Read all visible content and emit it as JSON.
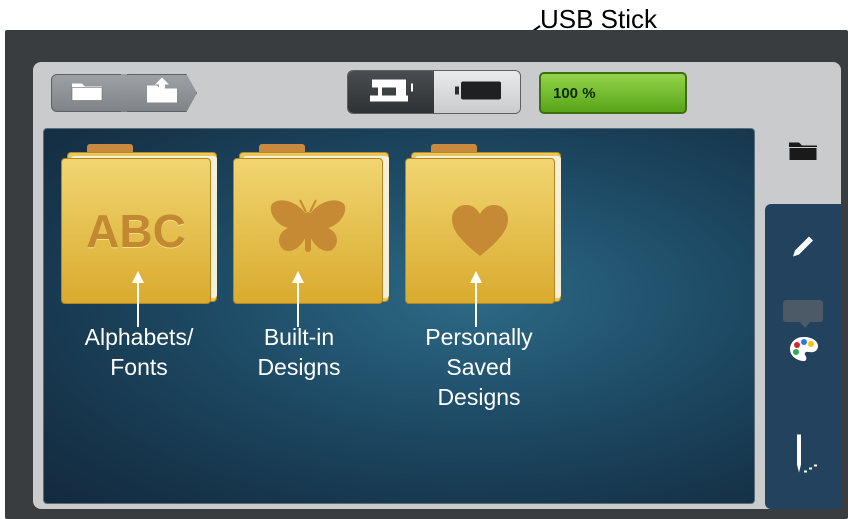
{
  "callout": {
    "label": "USB Stick"
  },
  "breadcrumb": {
    "items": [
      {
        "icon": "folder-icon"
      },
      {
        "icon": "folder-upload-icon"
      }
    ]
  },
  "source_toggle": {
    "options": [
      {
        "icon": "sewing-machine-icon",
        "selected": false
      },
      {
        "icon": "usb-stick-icon",
        "selected": true
      }
    ]
  },
  "memory": {
    "label": "100 %",
    "fill_fraction": 1.0,
    "color": "#6fbf2a"
  },
  "side_tabs": [
    {
      "icon": "folder-icon",
      "active": true
    },
    {
      "icon": "pencil-icon",
      "active": false
    },
    {
      "icon": "palette-icon",
      "active": false
    },
    {
      "icon": "needle-stitch-icon",
      "active": false
    }
  ],
  "folders": [
    {
      "emblem_text": "ABC",
      "emblem": "abc-text"
    },
    {
      "emblem": "butterfly-icon"
    },
    {
      "emblem": "heart-icon"
    }
  ],
  "annotations": [
    {
      "lines": [
        "Alphabets/",
        "Fonts"
      ]
    },
    {
      "lines": [
        "Built-in",
        "Designs"
      ]
    },
    {
      "lines": [
        "Personally",
        "Saved",
        "Designs"
      ]
    }
  ],
  "colors": {
    "background_panel": "#1d4963",
    "folder": "#e9c75a",
    "emblem": "#c28930",
    "memory_green": "#6fbf2a"
  }
}
